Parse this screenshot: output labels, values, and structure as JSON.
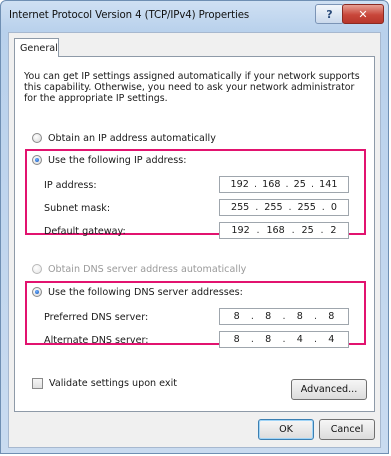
{
  "window": {
    "title": "Internet Protocol Version 4 (TCP/IPv4) Properties",
    "help_glyph": "?",
    "close_glyph": "✕"
  },
  "tabs": [
    {
      "label": "General",
      "selected": true
    }
  ],
  "intro_text": "You can get IP settings assigned automatically if your network supports this capability. Otherwise, you need to ask your network administrator for the appropriate IP settings.",
  "ip_mode": {
    "auto_label": "Obtain an IP address automatically",
    "manual_label": "Use the following IP address:",
    "selected": "manual"
  },
  "ip_fields": [
    {
      "label": "IP address:",
      "octets": [
        "192",
        "168",
        "25",
        "141"
      ]
    },
    {
      "label": "Subnet mask:",
      "octets": [
        "255",
        "255",
        "255",
        "0"
      ]
    },
    {
      "label": "Default gateway:",
      "octets": [
        "192",
        "168",
        "25",
        "2"
      ]
    }
  ],
  "dns_mode": {
    "auto_label": "Obtain DNS server address automatically",
    "manual_label": "Use the following DNS server addresses:",
    "selected": "manual"
  },
  "dns_fields": [
    {
      "label": "Preferred DNS server:",
      "octets": [
        "8",
        "8",
        "8",
        "8"
      ]
    },
    {
      "label": "Alternate DNS server:",
      "octets": [
        "8",
        "8",
        "4",
        "4"
      ]
    }
  ],
  "validate_label": "Validate settings upon exit",
  "validate_checked": false,
  "buttons": {
    "advanced": "Advanced...",
    "ok": "OK",
    "cancel": "Cancel"
  },
  "colors": {
    "highlight": "#e2136f",
    "radio_selected": "#1a56b8"
  }
}
